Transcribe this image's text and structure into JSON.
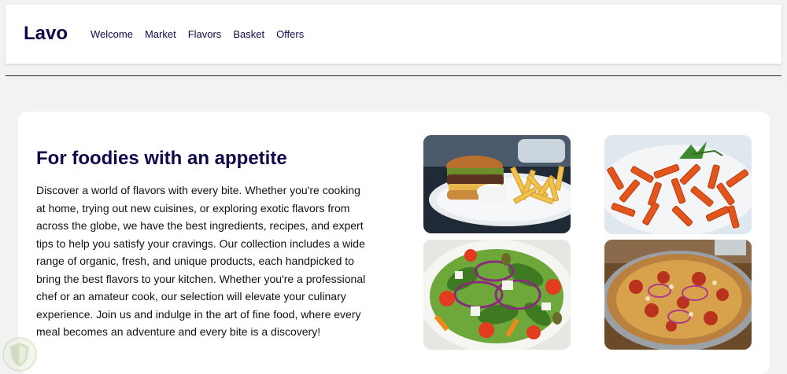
{
  "header": {
    "brand": "Lavo",
    "nav": [
      "Welcome",
      "Market",
      "Flavors",
      "Basket",
      "Offers"
    ]
  },
  "hero": {
    "title": "For foodies with an appetite",
    "body": "Discover a world of flavors with every bite. Whether you're cooking at home, trying out new cuisines, or exploring exotic flavors from across the globe, we have the best ingredients, recipes, and expert tips to help you satisfy your cravings. Our collection includes a wide range of organic, fresh, and unique products, each handpicked to bring the best flavors to your kitchen. Whether you're a professional chef or an amateur cook, our selection will elevate your culinary experience. Join us and indulge in the art of fine food, where every meal becomes an adventure and every bite is a discovery!"
  },
  "gallery": {
    "images": [
      "burger-and-fries",
      "penne-pasta",
      "salad",
      "pizza"
    ]
  },
  "colors": {
    "brand": "#0e0a4a",
    "background": "#f2f2f2",
    "card": "#ffffff"
  }
}
